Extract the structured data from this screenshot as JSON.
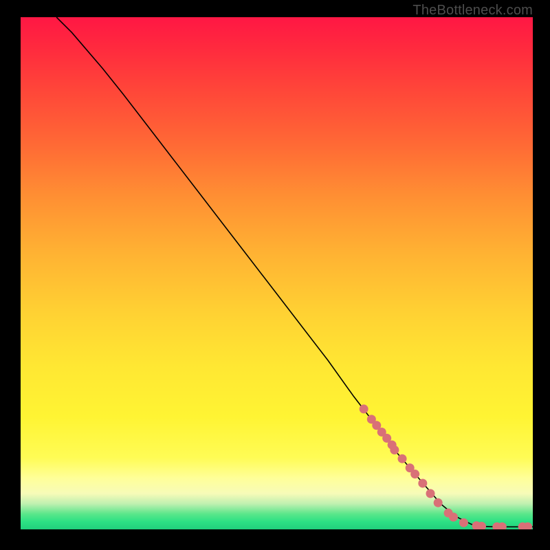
{
  "watermark": "TheBottleneck.com",
  "chart_data": {
    "type": "line",
    "title": "",
    "xlabel": "",
    "ylabel": "",
    "xlim": [
      0,
      100
    ],
    "ylim": [
      0,
      100
    ],
    "series": [
      {
        "name": "curve",
        "x": [
          7,
          10,
          13,
          16,
          20,
          25,
          30,
          35,
          40,
          45,
          50,
          55,
          60,
          65,
          70,
          73,
          76,
          79,
          82,
          85,
          88,
          90,
          93,
          100
        ],
        "y": [
          100,
          97,
          93.5,
          90,
          85,
          78.5,
          72,
          65.5,
          59,
          52.5,
          46,
          39.5,
          33,
          26,
          19.5,
          15.5,
          12,
          8.5,
          5,
          2.5,
          1,
          0.6,
          0.5,
          0.5
        ]
      }
    ],
    "highlight_points": {
      "name": "dots",
      "color": "#d97077",
      "x": [
        67,
        68.5,
        69.5,
        70.5,
        71.5,
        72.5,
        73,
        74.5,
        76,
        77,
        78.5,
        80,
        81.5,
        83.5,
        84.5,
        86.5,
        89,
        90,
        93,
        94,
        98,
        99
      ],
      "y": [
        23.5,
        21.5,
        20.3,
        19,
        17.8,
        16.5,
        15.5,
        13.8,
        12,
        10.8,
        9,
        7,
        5.2,
        3.2,
        2.4,
        1.3,
        0.7,
        0.6,
        0.5,
        0.5,
        0.5,
        0.5
      ]
    }
  }
}
